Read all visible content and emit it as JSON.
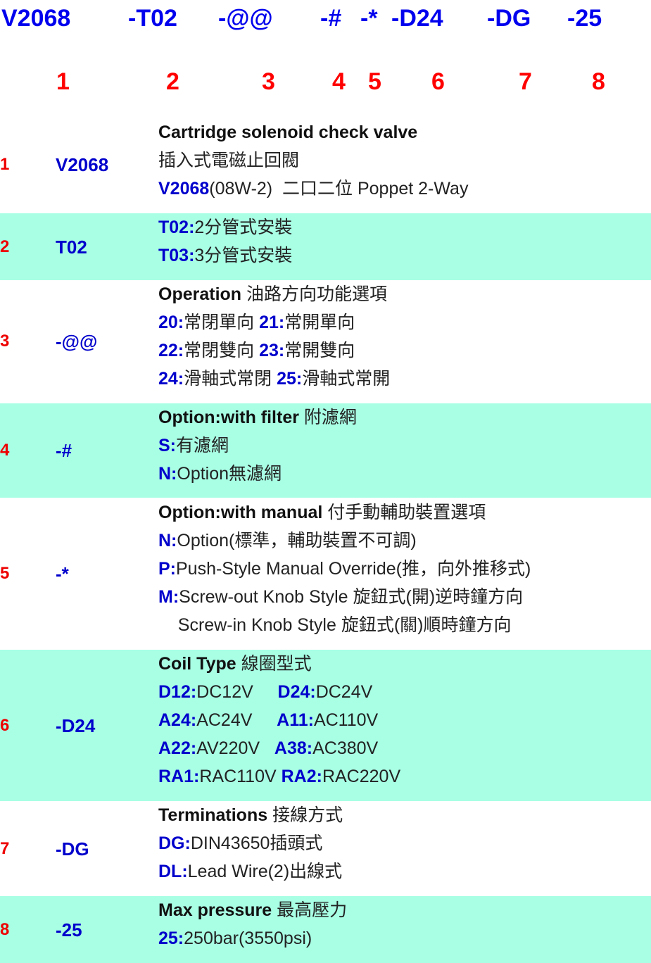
{
  "header": {
    "codes": [
      "V2068",
      "-T02",
      "-@@",
      "-#",
      "-*",
      "-D24",
      "-DG",
      "-25"
    ],
    "numbers": [
      "1",
      "2",
      "3",
      "4",
      "5",
      "6",
      "7",
      "8"
    ]
  },
  "rows": [
    {
      "num": "1",
      "code": "V2068",
      "lines": [
        [
          {
            "s": "t",
            "v": "Cartridge solenoid check valve"
          }
        ],
        [
          {
            "s": "",
            "v": "插入式電磁止回閥"
          }
        ],
        [
          {
            "s": "k",
            "v": "V2068"
          },
          {
            "s": "",
            "v": "(08W-2)  二口二位 Poppet 2-Way"
          }
        ]
      ]
    },
    {
      "num": "2",
      "code": "T02",
      "lines": [
        [
          {
            "s": "k",
            "v": "T02:"
          },
          {
            "s": "",
            "v": "2分管式安裝"
          }
        ],
        [
          {
            "s": "k",
            "v": "T03:"
          },
          {
            "s": "",
            "v": "3分管式安裝"
          }
        ]
      ]
    },
    {
      "num": "3",
      "code": "-@@",
      "lines": [
        [
          {
            "s": "t",
            "v": "Operation"
          },
          {
            "s": "",
            "v": " 油路方向功能選項"
          }
        ],
        [
          {
            "s": "k",
            "v": "20:"
          },
          {
            "s": "",
            "v": "常閉單向 "
          },
          {
            "s": "k",
            "v": "21:"
          },
          {
            "s": "",
            "v": "常開單向"
          }
        ],
        [
          {
            "s": "k",
            "v": "22:"
          },
          {
            "s": "",
            "v": "常閉雙向 "
          },
          {
            "s": "k",
            "v": "23:"
          },
          {
            "s": "",
            "v": "常開雙向"
          }
        ],
        [
          {
            "s": "k",
            "v": "24:"
          },
          {
            "s": "",
            "v": "滑軸式常閉 "
          },
          {
            "s": "k",
            "v": "25:"
          },
          {
            "s": "",
            "v": "滑軸式常開"
          }
        ]
      ]
    },
    {
      "num": "4",
      "code": "-#",
      "lines": [
        [
          {
            "s": "t",
            "v": "Option:with filter"
          },
          {
            "s": "",
            "v": " 附濾網"
          }
        ],
        [
          {
            "s": "k",
            "v": "S:"
          },
          {
            "s": "",
            "v": "有濾網"
          }
        ],
        [
          {
            "s": "k",
            "v": "N:"
          },
          {
            "s": "",
            "v": "Option無濾網"
          }
        ]
      ]
    },
    {
      "num": "5",
      "code": "-*",
      "lines": [
        [
          {
            "s": "t",
            "v": "Option:with manual"
          },
          {
            "s": "",
            "v": " 付手動輔助裝置選項"
          }
        ],
        [
          {
            "s": "k",
            "v": "N:"
          },
          {
            "s": "",
            "v": "Option(標準，輔助裝置不可調)"
          }
        ],
        [
          {
            "s": "k",
            "v": "P:"
          },
          {
            "s": "",
            "v": "Push-Style Manual Override(推，向外推移式)"
          }
        ],
        [
          {
            "s": "k",
            "v": "M:"
          },
          {
            "s": "",
            "v": "Screw-out Knob Style 旋鈕式(開)逆時鐘方向"
          }
        ],
        [
          {
            "s": "",
            "v": "    Screw-in Knob Style 旋鈕式(關)順時鐘方向"
          }
        ]
      ]
    },
    {
      "num": "6",
      "code": "-D24",
      "lines": [
        [
          {
            "s": "t",
            "v": "Coil Type"
          },
          {
            "s": "",
            "v": " 線圈型式"
          }
        ],
        [
          {
            "s": "k",
            "v": "D12:"
          },
          {
            "s": "",
            "v": "DC12V     "
          },
          {
            "s": "k",
            "v": "D24:"
          },
          {
            "s": "",
            "v": "DC24V"
          }
        ],
        [
          {
            "s": "k",
            "v": "A24:"
          },
          {
            "s": "",
            "v": "AC24V     "
          },
          {
            "s": "k",
            "v": "A11:"
          },
          {
            "s": "",
            "v": "AC110V"
          }
        ],
        [
          {
            "s": "k",
            "v": "A22:"
          },
          {
            "s": "",
            "v": "AV220V   "
          },
          {
            "s": "k",
            "v": "A38:"
          },
          {
            "s": "",
            "v": "AC380V"
          }
        ],
        [
          {
            "s": "k",
            "v": "RA1:"
          },
          {
            "s": "",
            "v": "RAC110V "
          },
          {
            "s": "k",
            "v": "RA2:"
          },
          {
            "s": "",
            "v": "RAC220V"
          }
        ]
      ]
    },
    {
      "num": "7",
      "code": "-DG",
      "lines": [
        [
          {
            "s": "t",
            "v": "Terminations"
          },
          {
            "s": "",
            "v": " 接線方式"
          }
        ],
        [
          {
            "s": "k",
            "v": "DG:"
          },
          {
            "s": "",
            "v": "DIN43650插頭式"
          }
        ],
        [
          {
            "s": "k",
            "v": "DL:"
          },
          {
            "s": "",
            "v": "Lead Wire(2)出線式"
          }
        ]
      ]
    },
    {
      "num": "8",
      "code": "-25",
      "lines": [
        [
          {
            "s": "t",
            "v": "Max pressure"
          },
          {
            "s": "",
            "v": " 最高壓力"
          }
        ],
        [
          {
            "s": "k",
            "v": "25:"
          },
          {
            "s": "",
            "v": "250bar(3550psi)"
          }
        ]
      ]
    }
  ]
}
